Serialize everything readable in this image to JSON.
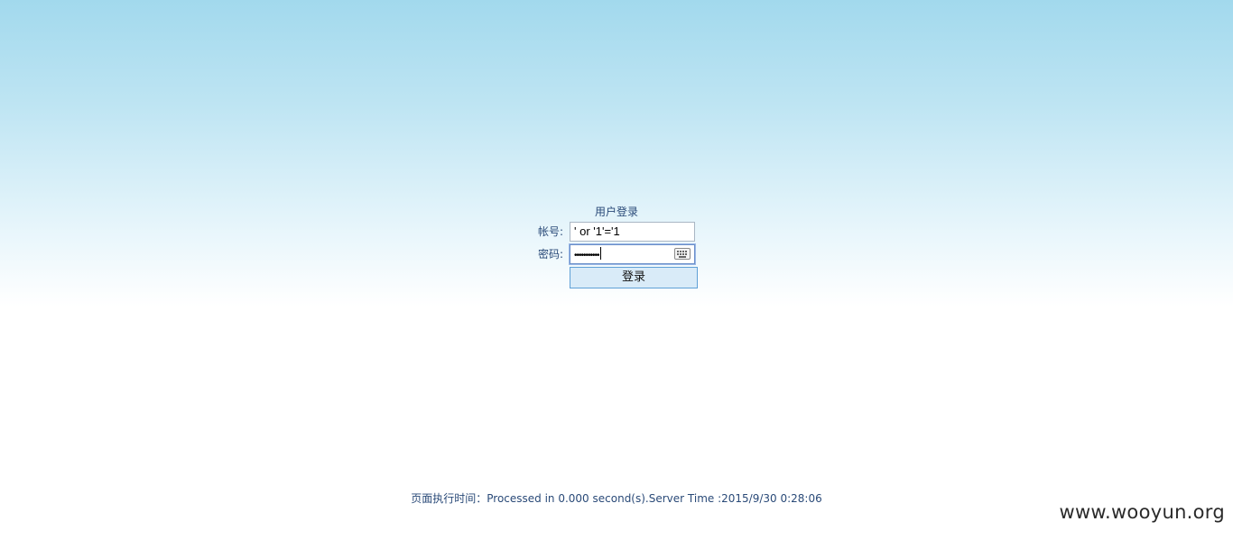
{
  "login": {
    "title": "用户登录",
    "username_label": "帐号:",
    "username_value": "' or '1'='1",
    "password_label": "密码:",
    "password_value": "•••••••••••",
    "submit_label": "登录"
  },
  "icons": {
    "password_keyboard": "keyboard-icon"
  },
  "footer": {
    "text": "页面执行时间：Processed in 0.000 second(s).Server Time :2015/9/30 0:28:06"
  },
  "watermark": {
    "text": "www.wooyun.org"
  },
  "colors": {
    "background_top": "#a2d9ed",
    "text_blue": "#2a4a78",
    "button_bg": "#d9ebf8",
    "button_border": "#5fa0d6"
  }
}
